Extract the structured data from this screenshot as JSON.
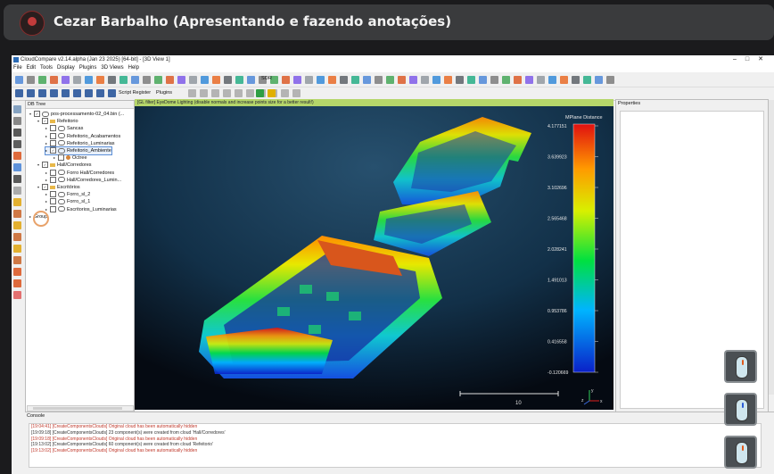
{
  "meeting": {
    "presenter": "Cezar Barbalho (Apresentando e fazendo anotações)"
  },
  "app": {
    "title": "CloudCompare v2.14.alpha (Jan 23 2025) [64-bit] - [3D View 1]",
    "menu": [
      "File",
      "Edit",
      "Tools",
      "Display",
      "Plugins",
      "3D Views",
      "Help"
    ],
    "toolbar": {
      "script_register": "Script Register",
      "plugins": "Plugins",
      "sor": "SOR"
    }
  },
  "dbtree": {
    "title": "DB Tree",
    "rows": [
      {
        "label": "pos-processamento-02_04.bin (...",
        "level": 0,
        "type": "file",
        "checked": "✓"
      },
      {
        "label": "Refeitorio",
        "level": 1,
        "type": "folder",
        "checked": "✓"
      },
      {
        "label": "Sancas",
        "level": 2,
        "type": "cloud",
        "checked": ""
      },
      {
        "label": "Refeitorio_Acabamentos",
        "level": 2,
        "type": "cloud",
        "checked": ""
      },
      {
        "label": "Refeitorio_Luminarias",
        "level": 2,
        "type": "cloud",
        "checked": ""
      },
      {
        "label": "Refeitorio_Ambiente",
        "level": 2,
        "type": "cloud",
        "checked": "✓",
        "selected": true
      },
      {
        "label": "Octree",
        "level": 3,
        "type": "octree",
        "checked": ""
      },
      {
        "label": "Hall/Corredores",
        "level": 1,
        "type": "folder",
        "checked": "✓"
      },
      {
        "label": "Forro Hall/Corredores",
        "level": 2,
        "type": "cloud",
        "checked": ""
      },
      {
        "label": "Hall/Corredores_Lumin...",
        "level": 2,
        "type": "cloud",
        "checked": ""
      },
      {
        "label": "Escritórios",
        "level": 1,
        "type": "folder",
        "checked": "✓"
      },
      {
        "label": "Forro_sl_2",
        "level": 2,
        "type": "cloud",
        "checked": ""
      },
      {
        "label": "Forro_sl_1",
        "level": 2,
        "type": "cloud",
        "checked": ""
      },
      {
        "label": "Escritorios_Luminarias",
        "level": 2,
        "type": "cloud",
        "checked": ""
      },
      {
        "label": "Group",
        "level": 0,
        "type": "group",
        "checked": ""
      }
    ]
  },
  "view3d": {
    "filter": "[GL filter] EyeDome Lighting (disable normals and increase points size for a better result!)",
    "scale_label": "10",
    "axes": [
      "z",
      "y",
      "x"
    ],
    "scalar_bar": {
      "title": "MPlane Distance",
      "ticks": [
        "4.177151",
        "3.639923",
        "3.102696",
        "2.565468",
        "2.028241",
        "1.491013",
        "0.953786",
        "0.416558",
        "-0.120669"
      ]
    }
  },
  "properties": {
    "title": "Properties"
  },
  "console": {
    "title": "Console",
    "lines": [
      {
        "text": "[19:04:41] [CreateComponentsClouds] Original cloud has been automatically hidden",
        "color": "red"
      },
      {
        "text": "[19:09:18] [CreateComponentsClouds] 23 component(s) were created from cloud 'Hall/Corredores'",
        "color": "dark"
      },
      {
        "text": "[19:09:18] [CreateComponentsClouds] Original cloud has been automatically hidden",
        "color": "red"
      },
      {
        "text": "[19:13:02] [CreateComponentsClouds] 60 component(s) were created from cloud 'Refeitorio'",
        "color": "dark"
      },
      {
        "text": "[19:13:02] [CreateComponentsClouds] Original cloud has been automatically hidden",
        "color": "red"
      }
    ]
  },
  "colors": {
    "accent_filter": "#b5d66a",
    "selection": "#5c8fd6",
    "log_red": "#c0392b"
  }
}
